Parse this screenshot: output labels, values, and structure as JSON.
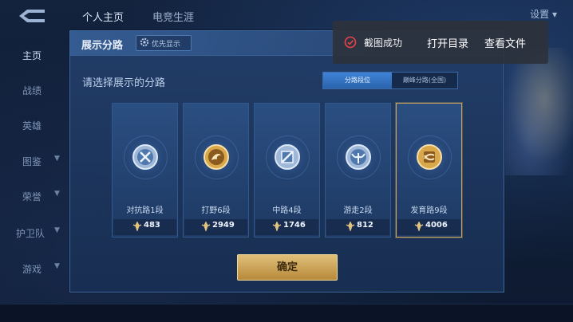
{
  "topbar": {
    "tabs": [
      "个人主页",
      "电竞生涯"
    ],
    "settings_label": "设置"
  },
  "sidebar": {
    "items": [
      {
        "label": "主页",
        "active": true,
        "chevron": false
      },
      {
        "label": "战绩",
        "active": false,
        "chevron": false
      },
      {
        "label": "英雄",
        "active": false,
        "chevron": false
      },
      {
        "label": "图鉴",
        "active": false,
        "chevron": true
      },
      {
        "label": "荣誉",
        "active": false,
        "chevron": true
      },
      {
        "label": "护卫队",
        "active": false,
        "chevron": true
      },
      {
        "label": "游戏",
        "active": false,
        "chevron": true
      }
    ]
  },
  "panel": {
    "title": "展示分路",
    "priority_label": "优先显示",
    "prompt": "请选择展示的分路",
    "segments": [
      "分路段位",
      "巅峰分路(全国)"
    ],
    "active_segment": 0,
    "confirm_label": "确定"
  },
  "cards": [
    {
      "lane": "对抗路1段",
      "points": "483",
      "badge": "silver-sword-badge",
      "selected": false
    },
    {
      "lane": "打野6段",
      "points": "2949",
      "badge": "gold-dragon-badge",
      "selected": false
    },
    {
      "lane": "中路4段",
      "points": "1746",
      "badge": "silver-slash-badge",
      "selected": false
    },
    {
      "lane": "游走2段",
      "points": "812",
      "badge": "silver-wings-badge",
      "selected": false
    },
    {
      "lane": "发育路9段",
      "points": "4006",
      "badge": "gold-arrow-badge",
      "selected": true
    }
  ],
  "toast": {
    "message": "截图成功",
    "actions": [
      "打开目录",
      "查看文件"
    ]
  },
  "colors": {
    "accent_gold": "#c9a55d",
    "accent_blue": "#3f83d6",
    "toast_check": "#e8434a"
  }
}
